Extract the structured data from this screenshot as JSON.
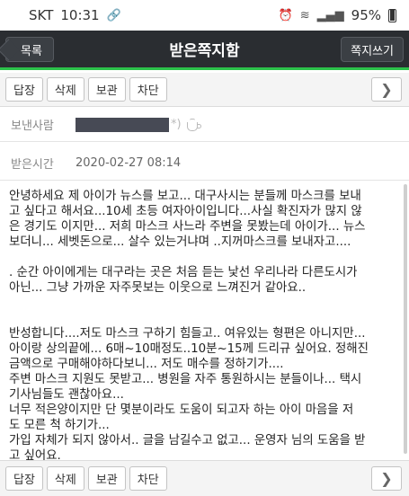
{
  "status_bar": {
    "carrier": "SKT",
    "time": "10:31",
    "battery": "95%"
  },
  "header": {
    "back_label": "목록",
    "title": "받은쪽지함",
    "compose_label": "쪽지쓰기"
  },
  "toolbar": {
    "reply": "답장",
    "delete": "삭제",
    "store": "보관",
    "block": "차단"
  },
  "sender": {
    "label": "보낸사람",
    "paren": "*)"
  },
  "received": {
    "label": "받은시간",
    "value": "2020-02-27 08:14"
  },
  "message": {
    "lines": [
      "안녕하세요 제 아이가 뉴스를 보고... 대구사시는 분들께 마스크를 보내",
      "고 싶다고 해서요...10세 초등 여자아이입니다...사실 확진자가 많지 않",
      "은 경기도 이지만... 저희 마스크 사느라 주변을 못봤는데 아이가... 뉴스",
      "보더니... 세벳돈으로... 살수 있는거냐며 ..지꺼마스크를 보내자고....",
      "",
      ". 순간 아이에게는 대구라는 곳은 처음 듣는 낯선 우리나라 다른도시가",
      "아닌... 그냥 가까운 자주못보는 이웃으로 느껴진거 같아요..",
      "",
      "",
      "반성합니다....저도 마스크 구하기 힘들고.. 여유있는 형편은 아니지만...",
      "아이랑 상의끝에... 6매~10매정도..10분~15께 드리규 싶어요. 정해진",
      "금액으로 구매해야하다보니... 저도 매수를 정하기가....",
      "주변 마스크 지원도 못받고... 병원을 자주 통원하시는 분들이나... 택시",
      "기사님들도 괜찮아요...",
      "너무 적은양이지만 단 몇분이라도  도움이 되고자 하는 아이 마음을 저",
      "도 모른 척 하기가...",
      "가입 자체가 되지 않아서.. 글을 남길수고 없고... 운영자 님의 도움을 받",
      "고 싶어요."
    ]
  }
}
